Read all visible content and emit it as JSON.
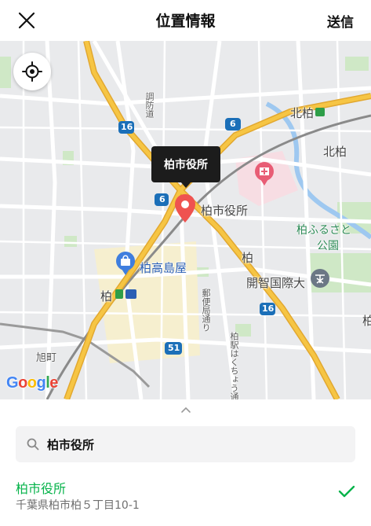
{
  "header": {
    "title": "位置情報",
    "send_label": "送信"
  },
  "map": {
    "labels": {
      "kitakashiwa_station": "北柏",
      "kitakashiwa_area": "北柏",
      "city_hall": "柏市役所",
      "furusato_park_1": "柏ふるさと",
      "furusato_park_2": "公園",
      "kaichi_univ": "開智国際大",
      "takashimaya": "柏高島屋",
      "kashiwa": "柏",
      "kashiwa_station": "柏",
      "asahicho": "旭町",
      "chofu": "調防道",
      "kashiwa_area": "柏",
      "right_edge": "柏",
      "route_6a": "6",
      "route_6b": "6",
      "route_16a": "16",
      "route_16b": "16",
      "route_51": "51",
      "street_a": "郵便局通り",
      "street_b": "柏駅はくちょう通り"
    },
    "tooltip": "柏市役所",
    "attribution": "Google"
  },
  "search": {
    "value": "柏市役所"
  },
  "result": {
    "name": "柏市役所",
    "address": "千葉県柏市柏５丁目10-1"
  },
  "colors": {
    "accent": "#06b34a",
    "pin": "#ef5350",
    "highway": "#f6c544"
  }
}
